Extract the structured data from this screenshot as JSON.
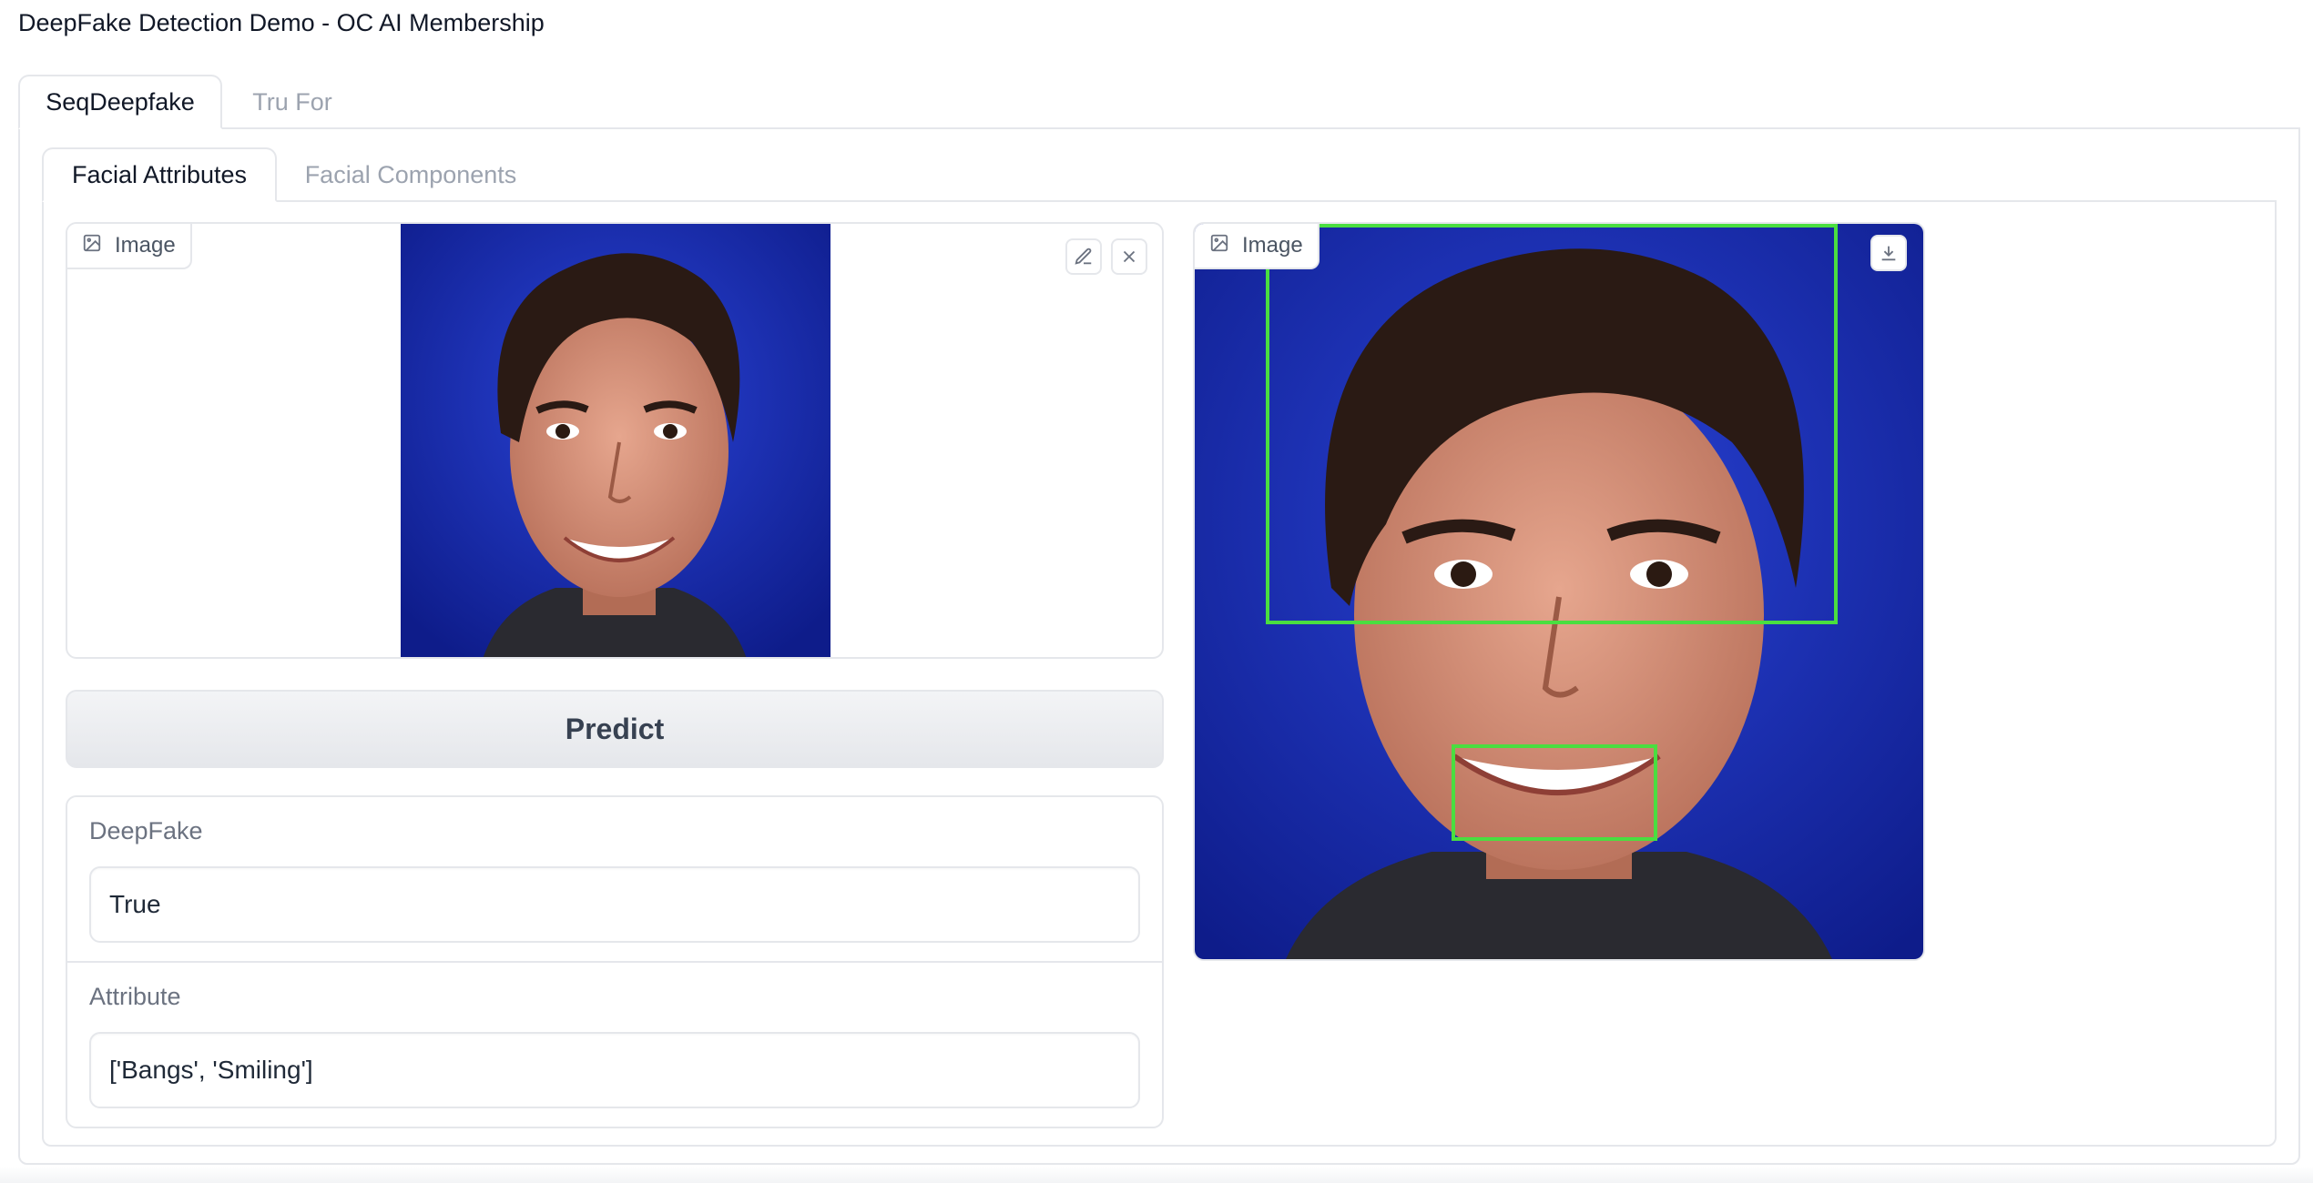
{
  "app": {
    "title": "DeepFake Detection Demo - OC AI Membership"
  },
  "outer_tabs": [
    {
      "label": "SeqDeepfake",
      "active": true
    },
    {
      "label": "Tru For",
      "active": false
    }
  ],
  "inner_tabs": [
    {
      "label": "Facial Attributes",
      "active": true
    },
    {
      "label": "Facial Components",
      "active": false
    }
  ],
  "input_image": {
    "label": "Image",
    "icons": [
      "image-icon",
      "edit-icon",
      "close-icon"
    ]
  },
  "predict_button": {
    "label": "Predict"
  },
  "results": {
    "deepfake": {
      "label": "DeepFake",
      "value": "True"
    },
    "attribute": {
      "label": "Attribute",
      "value": "['Bangs', 'Smiling']"
    }
  },
  "output_image": {
    "label": "Image",
    "icons": [
      "image-icon",
      "download-icon"
    ]
  },
  "colors": {
    "accent_box": "#4ade40",
    "background_blue": "#1a2fb0",
    "border": "#e5e7eb"
  }
}
